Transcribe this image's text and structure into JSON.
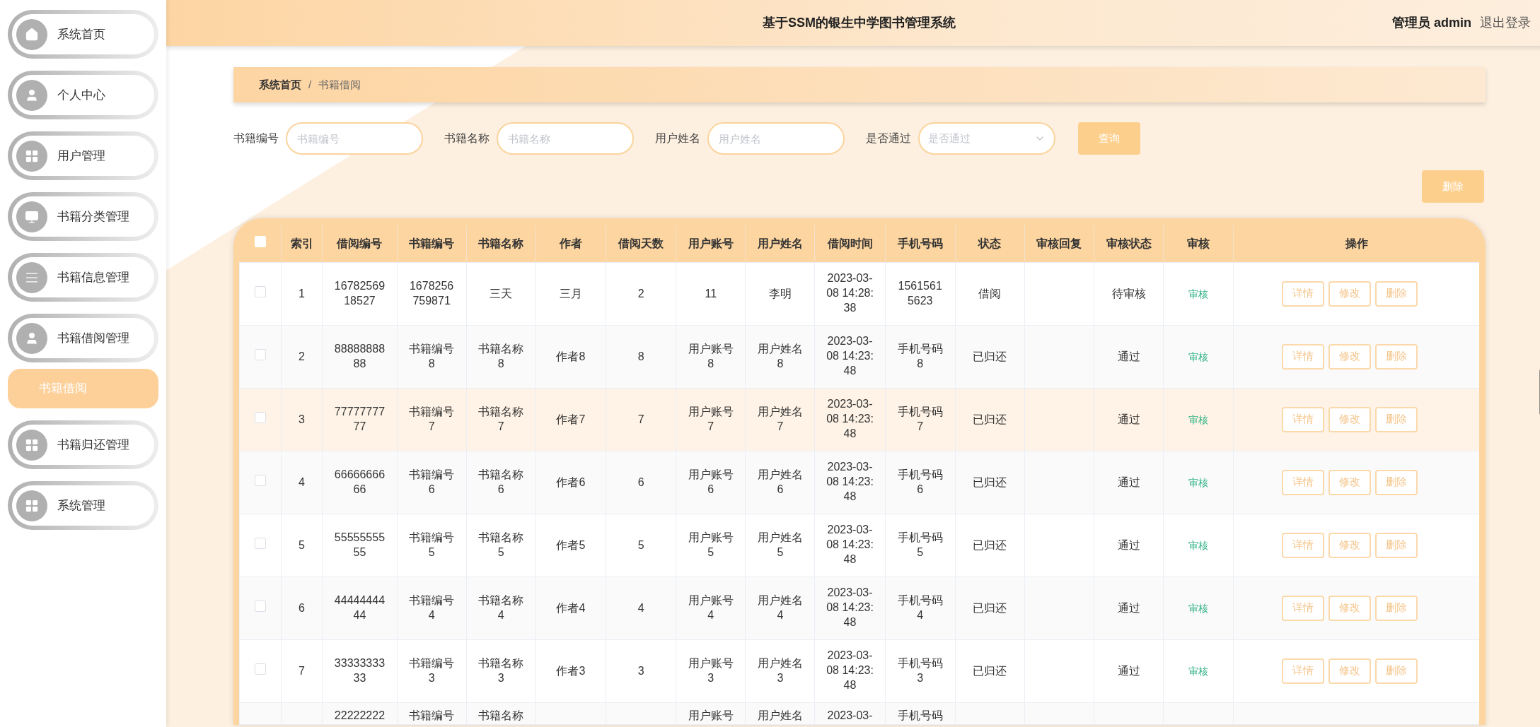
{
  "header": {
    "title": "基于SSM的银生中学图书管理系统",
    "user_label": "管理员 admin",
    "logout": "退出登录"
  },
  "sidebar": {
    "items": [
      {
        "label": "系统首页"
      },
      {
        "label": "个人中心"
      },
      {
        "label": "用户管理"
      },
      {
        "label": "书籍分类管理"
      },
      {
        "label": "书籍信息管理"
      },
      {
        "label": "书籍借阅管理",
        "children": [
          {
            "label": "书籍借阅",
            "selected": true
          }
        ]
      },
      {
        "label": "书籍归还管理"
      },
      {
        "label": "系统管理"
      }
    ]
  },
  "breadcrumb": {
    "separator": "/",
    "items": [
      "系统首页",
      "书籍借阅"
    ]
  },
  "search": {
    "fields": [
      {
        "kind": "text",
        "label": "书籍编号",
        "placeholder": "书籍编号"
      },
      {
        "kind": "text",
        "label": "书籍名称",
        "placeholder": "书籍名称"
      },
      {
        "kind": "text",
        "label": "用户姓名",
        "placeholder": "用户姓名"
      },
      {
        "kind": "select",
        "label": "是否通过",
        "placeholder": "是否通过"
      }
    ],
    "button": "查询"
  },
  "delete_button": "删除",
  "table": {
    "header_checked": false,
    "columns": [
      "索引",
      "借阅编号",
      "书籍编号",
      "书籍名称",
      "作者",
      "借阅天数",
      "用户账号",
      "用户姓名",
      "借阅时间",
      "手机号码",
      "状态",
      "审核回复",
      "审核状态",
      "审核",
      "操作"
    ],
    "rows": [
      {
        "checked": false,
        "hovered": false,
        "cells": [
          "1",
          "1678256918527",
          "1678256759871",
          "三天",
          "三月",
          "2",
          "11",
          "李明",
          "2023-03-08 14:28:38",
          "15615615623",
          "借阅",
          null,
          "待审核"
        ],
        "audit": "审核",
        "actions": [
          "详情",
          "修改",
          "删除"
        ]
      },
      {
        "checked": false,
        "hovered": false,
        "cells": [
          "2",
          "8888888888",
          "书籍编号8",
          "书籍名称8",
          "作者8",
          "8",
          "用户账号8",
          "用户姓名8",
          "2023-03-08 14:23:48",
          "手机号码8",
          "已归还",
          null,
          "通过"
        ],
        "audit": "审核",
        "actions": [
          "详情",
          "修改",
          "删除"
        ]
      },
      {
        "checked": false,
        "hovered": true,
        "cells": [
          "3",
          "7777777777",
          "书籍编号7",
          "书籍名称7",
          "作者7",
          "7",
          "用户账号7",
          "用户姓名7",
          "2023-03-08 14:23:48",
          "手机号码7",
          "已归还",
          null,
          "通过"
        ],
        "audit": "审核",
        "actions": [
          "详情",
          "修改",
          "删除"
        ]
      },
      {
        "checked": false,
        "hovered": false,
        "cells": [
          "4",
          "6666666666",
          "书籍编号6",
          "书籍名称6",
          "作者6",
          "6",
          "用户账号6",
          "用户姓名6",
          "2023-03-08 14:23:48",
          "手机号码6",
          "已归还",
          null,
          "通过"
        ],
        "audit": "审核",
        "actions": [
          "详情",
          "修改",
          "删除"
        ]
      },
      {
        "checked": false,
        "hovered": false,
        "cells": [
          "5",
          "5555555555",
          "书籍编号5",
          "书籍名称5",
          "作者5",
          "5",
          "用户账号5",
          "用户姓名5",
          "2023-03-08 14:23:48",
          "手机号码5",
          "已归还",
          null,
          "通过"
        ],
        "audit": "审核",
        "actions": [
          "详情",
          "修改",
          "删除"
        ]
      },
      {
        "checked": false,
        "hovered": false,
        "cells": [
          "6",
          "4444444444",
          "书籍编号4",
          "书籍名称4",
          "作者4",
          "4",
          "用户账号4",
          "用户姓名4",
          "2023-03-08 14:23:48",
          "手机号码4",
          "已归还",
          null,
          "通过"
        ],
        "audit": "审核",
        "actions": [
          "详情",
          "修改",
          "删除"
        ]
      },
      {
        "checked": false,
        "hovered": false,
        "cells": [
          "7",
          "3333333333",
          "书籍编号3",
          "书籍名称3",
          "作者3",
          "3",
          "用户账号3",
          "用户姓名3",
          "2023-03-08 14:23:48",
          "手机号码3",
          "已归还",
          null,
          "通过"
        ],
        "audit": "审核",
        "actions": [
          "详情",
          "修改",
          "删除"
        ]
      },
      {
        "hovered": false,
        "cells": [
          null,
          "22222222",
          "书籍编号",
          "书籍名称",
          null,
          null,
          "用户账号",
          "用户姓名",
          "2023-03-",
          "手机号码",
          null,
          null,
          null
        ]
      }
    ]
  }
}
